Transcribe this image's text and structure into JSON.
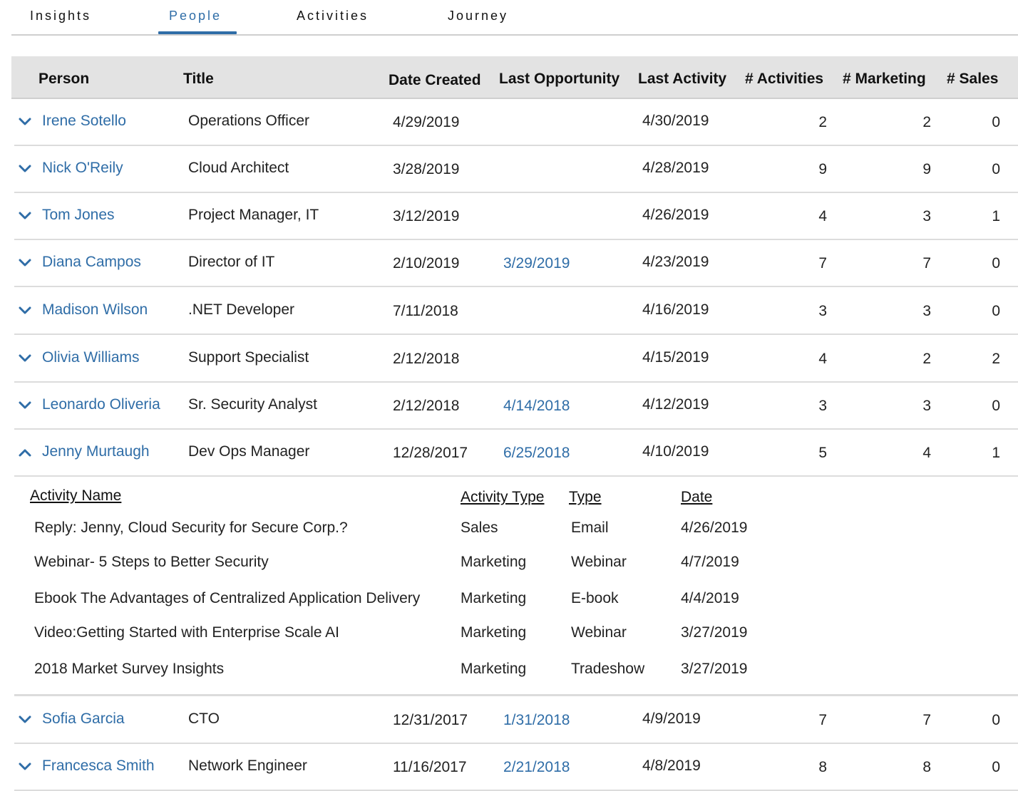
{
  "tabs": [
    {
      "label": "Insights",
      "active": false
    },
    {
      "label": "People",
      "active": true
    },
    {
      "label": "Activities",
      "active": false
    },
    {
      "label": "Journey",
      "active": false
    }
  ],
  "table": {
    "headers": {
      "person": "Person",
      "title": "Title",
      "date_created": "Date Created",
      "last_opportunity": "Last Opportunity",
      "last_activity": "Last Activity",
      "activities": "# Activities",
      "marketing": "# Marketing",
      "sales": "# Sales"
    },
    "rows": [
      {
        "person": "Irene Sotello",
        "title": "Operations Officer",
        "date_created": "4/29/2019",
        "last_opportunity": "",
        "last_activity": "4/30/2019",
        "activities": "2",
        "marketing": "2",
        "sales": "0",
        "expanded": false
      },
      {
        "person": "Nick O'Reily",
        "title": "Cloud Architect",
        "date_created": "3/28/2019",
        "last_opportunity": "",
        "last_activity": "4/28/2019",
        "activities": "9",
        "marketing": "9",
        "sales": "0",
        "expanded": false
      },
      {
        "person": "Tom Jones",
        "title": "Project Manager, IT",
        "date_created": "3/12/2019",
        "last_opportunity": "",
        "last_activity": "4/26/2019",
        "activities": "4",
        "marketing": "3",
        "sales": "1",
        "expanded": false
      },
      {
        "person": "Diana Campos",
        "title": "Director of IT",
        "date_created": "2/10/2019",
        "last_opportunity": "3/29/2019",
        "last_activity": "4/23/2019",
        "activities": "7",
        "marketing": "7",
        "sales": "0",
        "expanded": false
      },
      {
        "person": "Madison Wilson",
        "title": ".NET Developer",
        "date_created": "7/11/2018",
        "last_opportunity": "",
        "last_activity": "4/16/2019",
        "activities": "3",
        "marketing": "3",
        "sales": "0",
        "expanded": false
      },
      {
        "person": "Olivia Williams",
        "title": "Support Specialist",
        "date_created": "2/12/2018",
        "last_opportunity": "",
        "last_activity": "4/15/2019",
        "activities": "4",
        "marketing": "2",
        "sales": "2",
        "expanded": false
      },
      {
        "person": "Leonardo Oliveria",
        "title": "Sr. Security Analyst",
        "date_created": "2/12/2018",
        "last_opportunity": "4/14/2018",
        "last_activity": "4/12/2019",
        "activities": "3",
        "marketing": "3",
        "sales": "0",
        "expanded": false
      },
      {
        "person": "Jenny Murtaugh",
        "title": "Dev Ops Manager",
        "date_created": "12/28/2017",
        "last_opportunity": "6/25/2018",
        "last_activity": "4/10/2019",
        "activities": "5",
        "marketing": "4",
        "sales": "1",
        "expanded": true
      },
      {
        "person": "Sofia Garcia",
        "title": "CTO",
        "date_created": "12/31/2017",
        "last_opportunity": "1/31/2018",
        "last_activity": "4/9/2019",
        "activities": "7",
        "marketing": "7",
        "sales": "0",
        "expanded": false
      },
      {
        "person": "Francesca Smith",
        "title": "Network Engineer",
        "date_created": "11/16/2017",
        "last_opportunity": "2/21/2018",
        "last_activity": "4/8/2019",
        "activities": "8",
        "marketing": "8",
        "sales": "0",
        "expanded": false
      }
    ]
  },
  "detail": {
    "headers": {
      "activity_name": "Activity Name",
      "activity_type": "Activity Type",
      "type": "Type",
      "date": "Date"
    },
    "rows": [
      {
        "activity_name": "Reply: Jenny, Cloud Security for Secure Corp.?",
        "activity_type": "Sales",
        "type": "Email",
        "date": "4/26/2019"
      },
      {
        "activity_name": "Webinar- 5 Steps to Better Security",
        "activity_type": "Marketing",
        "type": "Webinar",
        "date": "4/7/2019"
      },
      {
        "activity_name": "Ebook The Advantages of Centralized Application Delivery",
        "activity_type": "Marketing",
        "type": "E-book",
        "date": "4/4/2019"
      },
      {
        "activity_name": "Video:Getting Started with Enterprise Scale AI",
        "activity_type": "Marketing",
        "type": "Webinar",
        "date": "3/27/2019"
      },
      {
        "activity_name": "2018 Market Survey Insights",
        "activity_type": "Marketing",
        "type": "Tradeshow",
        "date": "3/27/2019"
      }
    ]
  },
  "colors": {
    "accent": "#2f6da7",
    "header_bg": "#e3e3e3",
    "divider": "#dcdcdc"
  },
  "icons": {
    "collapsed": "chevron-down-icon",
    "expanded": "chevron-up-icon"
  }
}
